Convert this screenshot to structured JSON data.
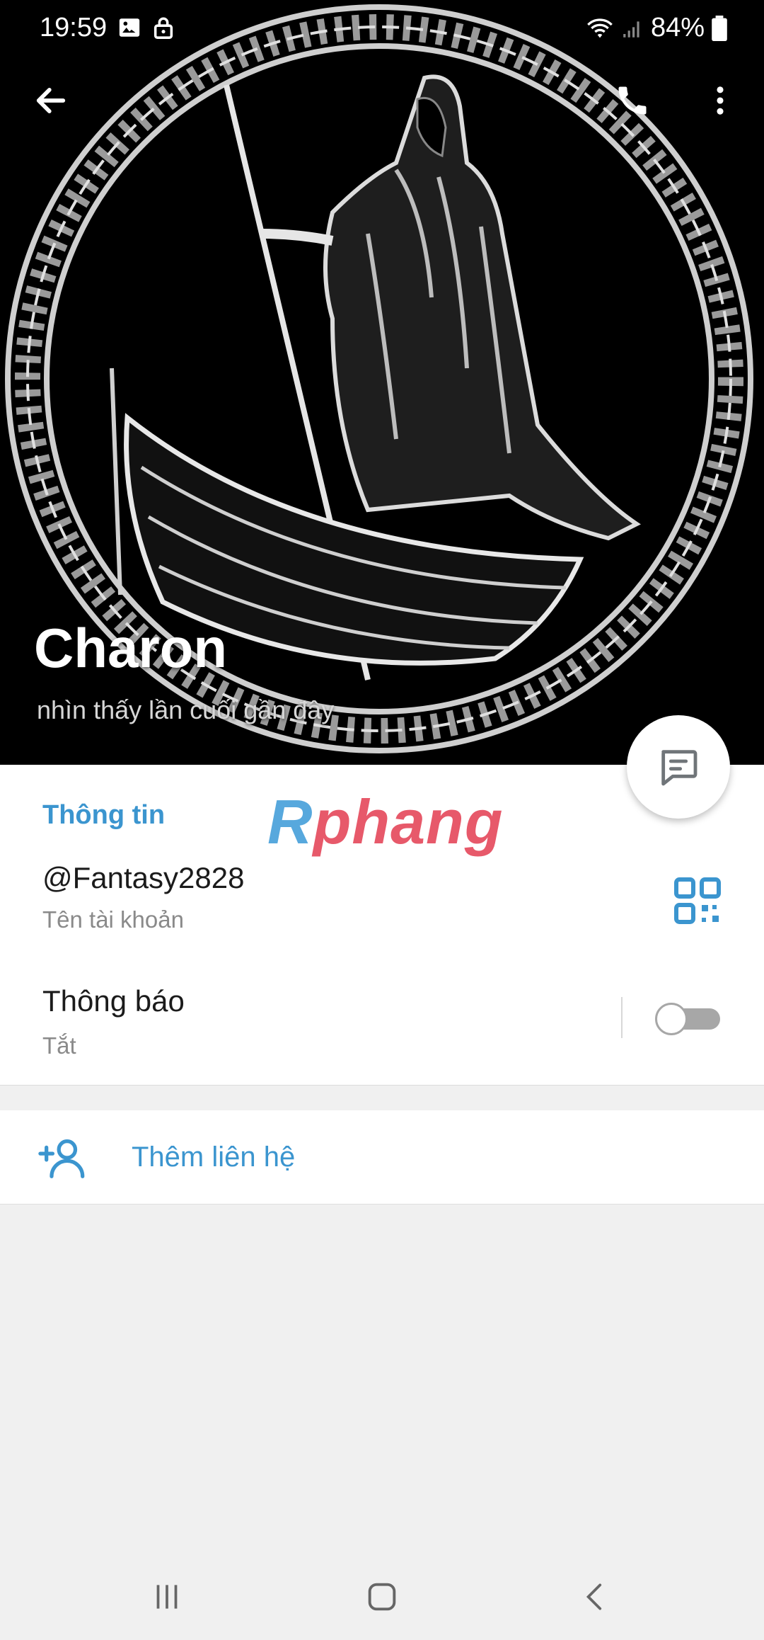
{
  "status_bar": {
    "time": "19:59",
    "battery": "84%",
    "icons": [
      "image-icon",
      "lock-icon",
      "wifi-icon",
      "signal-icon",
      "battery-icon"
    ]
  },
  "toolbar": {
    "back_icon": "arrow-left-icon",
    "call_icon": "phone-icon",
    "more_icon": "more-vertical-icon"
  },
  "profile": {
    "name": "Charon",
    "last_seen": "nhìn thấy lần cuối gần đây"
  },
  "info": {
    "section_title": "Thông tin",
    "watermark_logo": "Rphang",
    "username": "@Fantasy2828",
    "username_label": "Tên tài khoản",
    "notifications_label": "Thông báo",
    "notifications_state": "Tắt"
  },
  "actions": {
    "add_contact": "Thêm liên hệ"
  },
  "colors": {
    "accent": "#3b95cf",
    "header_bg": "#000000",
    "page_bg": "#f0f0f0"
  }
}
